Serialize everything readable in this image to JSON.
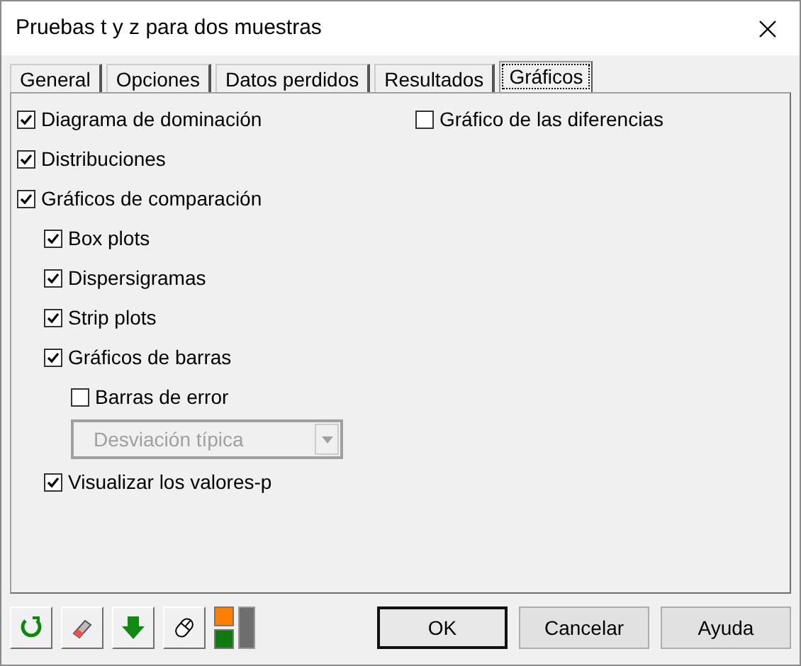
{
  "window": {
    "title": "Pruebas t y z para dos muestras"
  },
  "tabs": [
    {
      "label": "General",
      "selected": false
    },
    {
      "label": "Opciones",
      "selected": false
    },
    {
      "label": "Datos perdidos",
      "selected": false
    },
    {
      "label": "Resultados",
      "selected": false
    },
    {
      "label": "Gráficos",
      "selected": true
    }
  ],
  "left_options": [
    {
      "kind": "checkbox",
      "label": "Diagrama de dominación",
      "checked": true
    },
    {
      "kind": "checkbox",
      "label": "Distribuciones",
      "checked": true
    },
    {
      "kind": "checkbox",
      "label": "Gráficos de comparación",
      "checked": true,
      "children": [
        {
          "kind": "checkbox",
          "label": "Box plots",
          "checked": true
        },
        {
          "kind": "checkbox",
          "label": "Dispersigramas",
          "checked": true
        },
        {
          "kind": "checkbox",
          "label": "Strip plots",
          "checked": true
        },
        {
          "kind": "checkbox",
          "label": "Gráficos de barras",
          "checked": true,
          "children": [
            {
              "kind": "checkbox",
              "label": "Barras de error",
              "checked": false
            },
            {
              "kind": "dropdown",
              "value": "Desviación típica",
              "disabled": true
            }
          ]
        },
        {
          "kind": "checkbox",
          "label": "Visualizar los valores-p",
          "checked": true
        }
      ]
    }
  ],
  "right_options": [
    {
      "kind": "checkbox",
      "label": "Gráfico de las diferencias",
      "checked": false
    }
  ],
  "buttons": [
    {
      "label": "OK",
      "default": true
    },
    {
      "label": "Cancelar",
      "default": false
    },
    {
      "label": "Ayuda",
      "default": false
    }
  ]
}
